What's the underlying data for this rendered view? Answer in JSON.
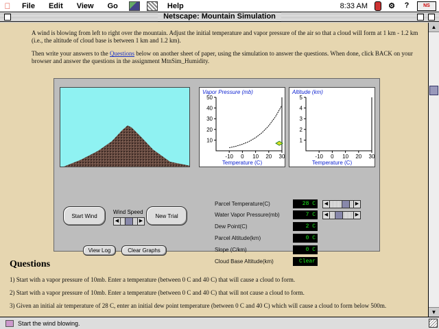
{
  "menubar": {
    "items": [
      "File",
      "Edit",
      "View",
      "Go",
      "Help"
    ],
    "clock": "8:33 AM"
  },
  "window": {
    "title": "Netscape: Mountain Simulation"
  },
  "intro": {
    "p1": "A wind is blowing from left to right over the mountain. Adjust the initial temperature and vapor pressure of the air so that a cloud will form at 1 km - 1.2 km (i.e., the altitude of cloud base is between 1 km and 1.2 km).",
    "p2_pre": "Then write your answers to the ",
    "p2_link": "Questions",
    "p2_post": " below on another sheet of paper, using the simulation to answer the questions. When done, click BACK on your browser and answer the questions in the assignment MtnSim_Humidity."
  },
  "applet": {
    "vp_graph": {
      "title": "Vapor Pressure (mb)",
      "xlabel": "Temperature (C)",
      "yticks": [
        "50",
        "40",
        "30",
        "20",
        "10"
      ],
      "xticks": [
        "-10",
        "0",
        "10",
        "20",
        "30"
      ]
    },
    "alt_graph": {
      "title": "Altitude (km)",
      "xlabel": "Temperature (C)",
      "yticks": [
        "5",
        "4",
        "3",
        "2",
        "1"
      ],
      "xticks": [
        "-10",
        "0",
        "10",
        "20",
        "30"
      ]
    },
    "buttons": {
      "start_wind": "Start Wind",
      "new_trial": "New Trial",
      "view_log": "View Log",
      "clear_graphs": "Clear Graphs"
    },
    "wind_speed_label": "Wind Speed",
    "wind_speed_level": 0.5,
    "temp_slider_level": 0.75,
    "vapor_slider_level": 0.3,
    "params": [
      {
        "label": "Parcel Temperature(C)",
        "value": "28 C"
      },
      {
        "label": "Water Vapor Pressure(mb)",
        "value": "7 C"
      },
      {
        "label": "Dew Point(C)",
        "value": "2 C"
      },
      {
        "label": "Parcel Altitude(km)",
        "value": "0 C"
      },
      {
        "label": "Slope (C/km)",
        "value": "0 C"
      },
      {
        "label": "Cloud Base Altitude(km)",
        "value": "Clear"
      }
    ]
  },
  "questions": {
    "heading": "Questions",
    "items": [
      "1) Start with a vapor pressure of 10mb. Enter a temperature (between 0 C and 40 C) that will cause a cloud to form.",
      "2) Start with a vapor pressure of 10mb. Enter a temperature (between 0 C and 40 C) that will not cause a cloud to form.",
      "3) Given an initial air temperature of 28 C, enter an initial dew point temperature (between 0 C and 40 C) which will cause a cloud to form below 500m."
    ]
  },
  "status": {
    "text": "Start the wind blowing."
  },
  "colors": {
    "page_bg": "#e6d6b0",
    "sky": "#8ff2f2",
    "lcd_text": "#1ef21e",
    "graph_label": "#0a1fd0"
  },
  "chart_data": [
    {
      "type": "line",
      "title": "Vapor Pressure (mb)",
      "xlabel": "Temperature (C)",
      "ylabel": "Vapor Pressure (mb)",
      "xlim": [
        -20,
        30
      ],
      "ylim": [
        0,
        50
      ],
      "series": [
        {
          "x": [
            -10,
            -5,
            0,
            5,
            10,
            15,
            20,
            25,
            30
          ],
          "values": [
            2.9,
            4.2,
            6.1,
            8.7,
            12.3,
            17.0,
            23.4,
            31.7,
            42.5
          ]
        }
      ],
      "points": [
        {
          "x": 28,
          "y": 7
        }
      ]
    },
    {
      "type": "scatter",
      "title": "Altitude (km)",
      "xlabel": "Temperature (C)",
      "ylabel": "Altitude (km)",
      "xlim": [
        -20,
        30
      ],
      "ylim": [
        0,
        5
      ],
      "series": []
    }
  ]
}
